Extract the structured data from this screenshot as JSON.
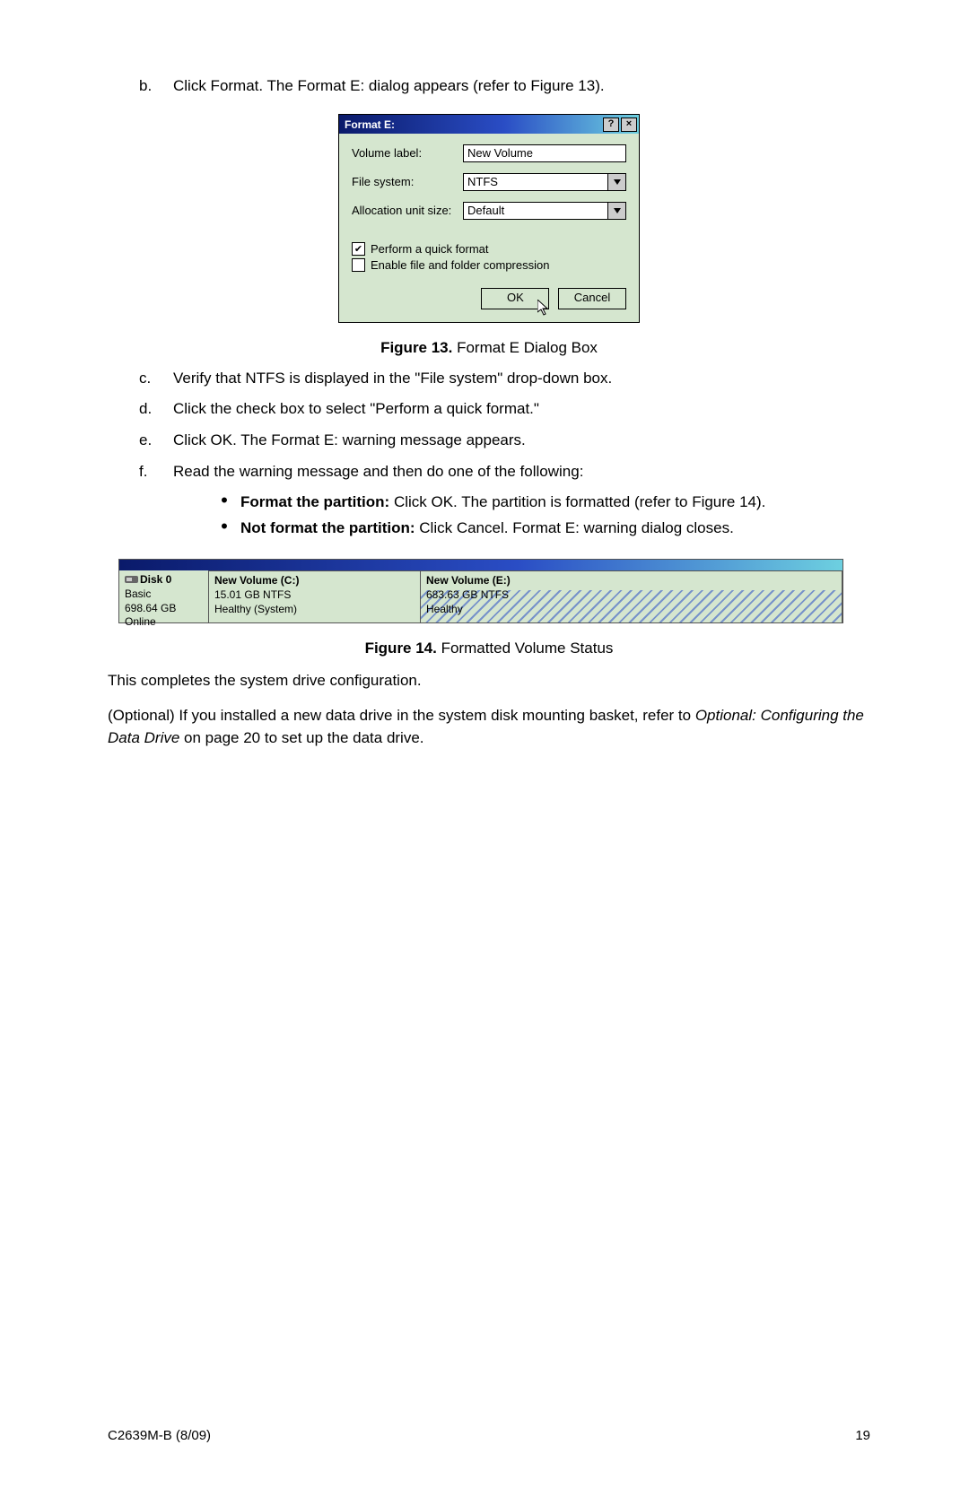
{
  "steps": {
    "b": {
      "letter": "b.",
      "text": "Click Format. The Format E: dialog appears (refer to Figure 13)."
    },
    "c": {
      "letter": "c.",
      "text": "Verify that NTFS is displayed in the \"File system\" drop-down box."
    },
    "d": {
      "letter": "d.",
      "text": "Click the check box to select \"Perform a quick format.\""
    },
    "e": {
      "letter": "e.",
      "text": "Click OK. The Format E: warning message appears."
    },
    "f": {
      "letter": "f.",
      "text": "Read the warning message and then do one of the following:"
    }
  },
  "bullets": {
    "a": {
      "bold": "Format the partition:",
      "rest": " Click OK. The partition is formatted (refer to Figure 14)."
    },
    "b": {
      "bold": "Not format the partition:",
      "rest": " Click Cancel. Format E: warning dialog closes."
    }
  },
  "dialog": {
    "title": "Format E:",
    "help": "?",
    "close": "×",
    "volume_label_lbl": "Volume label:",
    "volume_label_val": "New Volume",
    "file_system_lbl": "File system:",
    "file_system_val": "NTFS",
    "alloc_lbl": "Allocation unit size:",
    "alloc_val": "Default",
    "quick_format": "Perform a quick format",
    "compression": "Enable file and folder compression",
    "ok": "OK",
    "cancel": "Cancel",
    "quick_checked": "✔",
    "comp_checked": ""
  },
  "fig13": {
    "label": "Figure 13.",
    "text": "  Format E Dialog Box"
  },
  "fig14": {
    "label": "Figure 14.",
    "text": "  Formatted Volume Status"
  },
  "disk": {
    "name": "Disk 0",
    "type": "Basic",
    "size": "698.64 GB",
    "status": "Online",
    "volC": {
      "name": "New Volume  (C:)",
      "size": "15.01 GB NTFS",
      "health": "Healthy (System)"
    },
    "volE": {
      "name": "New Volume  (E:)",
      "size": "683.63 GB NTFS",
      "health": "Healthy"
    }
  },
  "para1": "This completes the system drive configuration.",
  "para2_a": "(Optional) If you installed a new data drive in the system disk mounting basket, refer to ",
  "para2_i": "Optional: Configuring the Data Drive",
  "para2_b": " on page 20 to set up the data drive.",
  "footer": {
    "left": "C2639M-B (8/09)",
    "right": "19"
  }
}
